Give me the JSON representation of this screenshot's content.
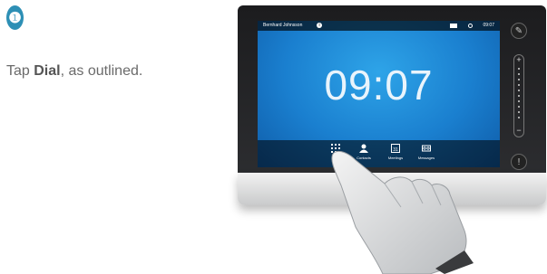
{
  "step": {
    "number": "❶",
    "color": "#2d8fb5"
  },
  "instruction": {
    "prefix": "Tap ",
    "action": "Dial",
    "suffix": ", as outlined."
  },
  "device": {
    "status_bar": {
      "user": "Bernhard Johnsson",
      "time": "09:07"
    },
    "clock": "09:07",
    "bottom_bar": {
      "items": [
        {
          "label": "Dial",
          "icon": "keypad-icon"
        },
        {
          "label": "Contacts",
          "icon": "person-icon"
        },
        {
          "label": "Meetings",
          "icon": "calendar-icon",
          "badge": "31"
        },
        {
          "label": "Messages",
          "icon": "voicemail-icon"
        }
      ]
    },
    "side_controls": {
      "mute_icon": "microphone-mute-icon",
      "volume_plus": "+",
      "volume_minus": "−",
      "alert_icon": "alert-icon"
    }
  }
}
